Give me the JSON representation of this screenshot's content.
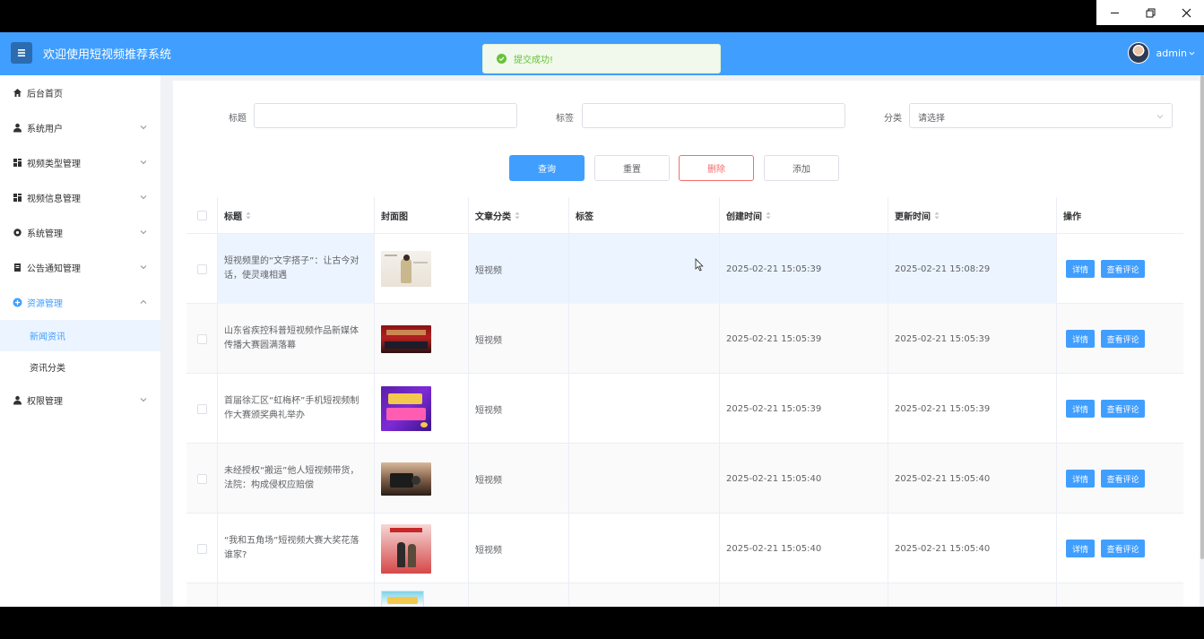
{
  "window": {
    "minimize_icon": "minimize-icon",
    "restore_icon": "restore-icon",
    "close_icon": "close-icon"
  },
  "header": {
    "title": "欢迎使用短视频推荐系统",
    "toast": "提交成功!",
    "user": "admin",
    "colors": {
      "brand": "#409eff",
      "success": "#67c23a",
      "danger": "#f56c6c"
    }
  },
  "sidebar": {
    "items": [
      {
        "label": "后台首页",
        "icon": "home-icon"
      },
      {
        "label": "系统用户",
        "icon": "user-icon"
      },
      {
        "label": "视频类型管理",
        "icon": "grid-icon"
      },
      {
        "label": "视频信息管理",
        "icon": "grid-icon"
      },
      {
        "label": "系统管理",
        "icon": "gear-icon"
      },
      {
        "label": "公告通知管理",
        "icon": "document-icon"
      },
      {
        "label": "资源管理",
        "icon": "plus-circle-icon"
      },
      {
        "label": "权限管理",
        "icon": "user-icon"
      }
    ],
    "sub_items": [
      "新闻资讯",
      "资讯分类"
    ]
  },
  "filters": {
    "title_label": "标题",
    "tag_label": "标签",
    "category_label": "分类",
    "category_placeholder": "请选择",
    "title_value": "",
    "tag_value": ""
  },
  "buttons": {
    "query": "查询",
    "reset": "重置",
    "delete": "删除",
    "add": "添加"
  },
  "table": {
    "headers": [
      "标题",
      "封面图",
      "文章分类",
      "标签",
      "创建时间",
      "更新时间",
      "操作"
    ],
    "rows": [
      {
        "title": "短视频里的“文字搭子”：让古今对话，使灵魂相遇",
        "category": "短视频",
        "tag": "",
        "created": "2025-02-21 15:05:39",
        "updated": "2025-02-21 15:08:29"
      },
      {
        "title": "山东省疾控科普短视频作品新媒体传播大赛圆满落幕",
        "category": "短视频",
        "tag": "",
        "created": "2025-02-21 15:05:39",
        "updated": "2025-02-21 15:05:39"
      },
      {
        "title": "首届徐汇区“虹梅杯”手机短视频制作大赛颁奖典礼举办",
        "category": "短视频",
        "tag": "",
        "created": "2025-02-21 15:05:39",
        "updated": "2025-02-21 15:05:39"
      },
      {
        "title": "未经授权“搬运”他人短视频带货，法院：构成侵权应赔偿",
        "category": "短视频",
        "tag": "",
        "created": "2025-02-21 15:05:40",
        "updated": "2025-02-21 15:05:40"
      },
      {
        "title": "“我和五角场”短视频大赛大奖花落谁家?",
        "category": "短视频",
        "tag": "",
        "created": "2025-02-21 15:05:40",
        "updated": "2025-02-21 15:05:40"
      }
    ],
    "detail_label": "详情",
    "comments_label": "查看评论"
  }
}
